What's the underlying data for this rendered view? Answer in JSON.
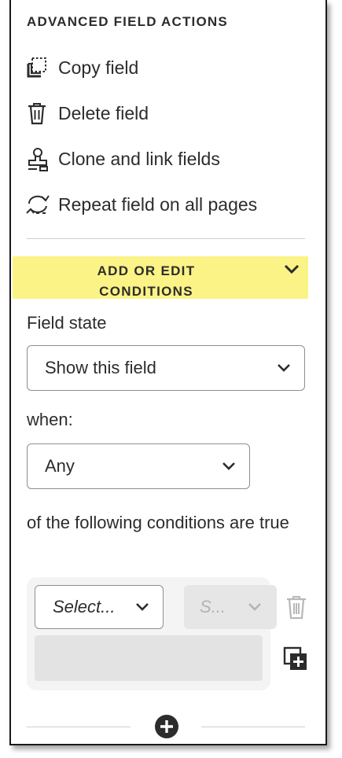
{
  "advanced": {
    "title": "ADVANCED FIELD ACTIONS",
    "actions": [
      {
        "label": "Copy field",
        "icon": "copy-icon"
      },
      {
        "label": "Delete field",
        "icon": "trash-icon"
      },
      {
        "label": "Clone and link fields",
        "icon": "stamp-icon"
      },
      {
        "label": "Repeat field on all pages",
        "icon": "repeat-icon"
      }
    ]
  },
  "conditions": {
    "header": "ADD OR EDIT CONDITIONS",
    "highlight_color": "#fbf385",
    "field_state_label": "Field state",
    "field_state_value": "Show this field",
    "when_label": "when:",
    "when_value": "Any",
    "following_label": "of the following conditions are true",
    "rule": {
      "field_select": "Select...",
      "operator_select": "S..."
    }
  }
}
